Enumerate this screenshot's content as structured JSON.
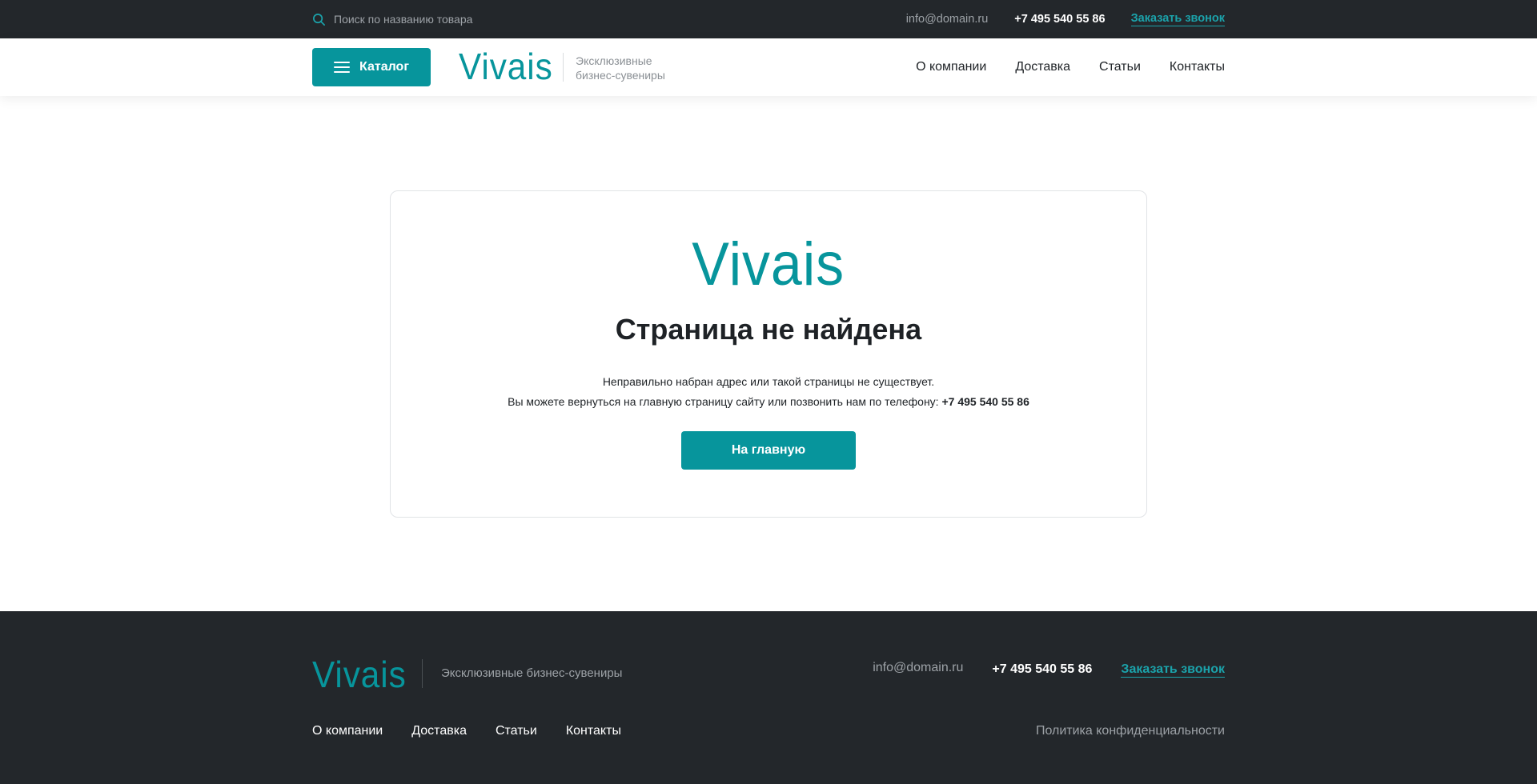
{
  "topbar": {
    "search_placeholder": "Поиск по названию товара",
    "email": "info@domain.ru",
    "phone": "+7 495 540 55 86",
    "callback_label": "Заказать звонок"
  },
  "header": {
    "catalog_label": "Каталог",
    "logo_text": "Vivais",
    "tagline_line1": "Эксклюзивные",
    "tagline_line2": "бизнес-сувениры",
    "nav": [
      {
        "label": "О компании"
      },
      {
        "label": "Доставка"
      },
      {
        "label": "Статьи"
      },
      {
        "label": "Контакты"
      }
    ]
  },
  "error_card": {
    "logo_text": "Vivais",
    "title": "Страница не найдена",
    "line1": "Неправильно набран адрес или такой страницы не существует.",
    "line2": "Вы можете вернуться на главную страницу сайту или позвонить нам по телефону:",
    "phone": "+7 495 540 55 86",
    "home_button_label": "На главную"
  },
  "footer": {
    "logo_text": "Vivais",
    "tagline": "Эксклюзивные бизнес-сувениры",
    "email": "info@domain.ru",
    "phone": "+7 495 540 55 86",
    "callback_label": "Заказать звонок",
    "nav": [
      {
        "label": "О компании"
      },
      {
        "label": "Доставка"
      },
      {
        "label": "Статьи"
      },
      {
        "label": "Контакты"
      }
    ],
    "privacy_label": "Политика конфиденциальности"
  },
  "colors": {
    "accent": "#07959c",
    "link_accent": "#1ba3ab",
    "dark_bg": "#23272b",
    "text": "#1e2226",
    "muted": "#9da2a7"
  },
  "icons": {
    "search": "search-icon",
    "menu": "menu-icon"
  }
}
